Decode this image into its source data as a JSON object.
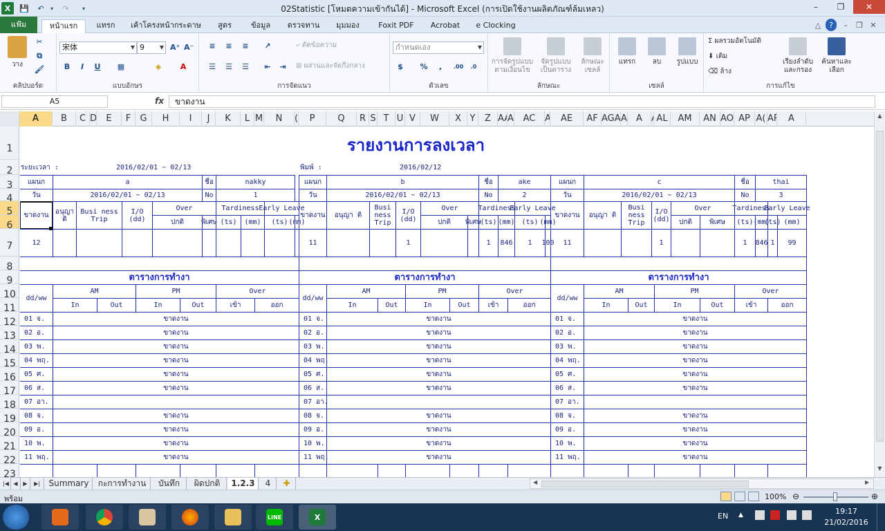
{
  "window": {
    "title": "02Statistic  [โหมดความเข้ากันได้] - Microsoft Excel (การเปิดใช้งานผลิตภัณฑ์ล้มเหลว)",
    "min": "–",
    "max": "❐",
    "close": "✕"
  },
  "ribbon_tabs": [
    "แฟ้ม",
    "หน้าแรก",
    "แทรก",
    "เค้าโครงหน้ากระดาษ",
    "สูตร",
    "ข้อมูล",
    "ตรวจทาน",
    "มุมมอง",
    "Foxit PDF",
    "Acrobat",
    "e Clocking"
  ],
  "ribbon": {
    "paste": "วาง",
    "clipboard": "คลิปบอร์ด",
    "font_name": "宋体",
    "font_size": "9",
    "font_group": "แบบอักษร",
    "wrap_text": "ตัดข้อความ",
    "merge_center": "ผสานและจัดกึ่งกลาง",
    "alignment_group": "การจัดแนว",
    "number_format": "กำหนดเอง",
    "number_group": "ตัวเลข",
    "cond_format": "การจัดรูปแบบ",
    "cond_format2": "ตามเงื่อนไข",
    "format_table": "จัดรูปแบบ",
    "format_table2": "เป็นตาราง",
    "cell_styles": "ลักษณะ",
    "cell_styles2": "เซลล์",
    "styles_group": "ลักษณะ",
    "insert": "แทรก",
    "delete": "ลบ",
    "format": "รูปแบบ",
    "cells_group": "เซลล์",
    "autosum": "ผลรวมอัตโนมัติ",
    "fill": "เติม",
    "clear": "ล้าง",
    "sort_filter": "เรียงลำดับ",
    "sort_filter2": "และกรอง",
    "find_select": "ค้นหาและ",
    "find_select2": "เลือก",
    "editing_group": "การแก้ไข",
    "percent": "%",
    "comma": ","
  },
  "formula_bar": {
    "name_box": "A5",
    "fx": "fx",
    "value": "ขาดงาน"
  },
  "columns": [
    "A",
    "B",
    "C",
    "D",
    "E",
    "F",
    "G",
    "H",
    "I",
    "J",
    "K",
    "L",
    "M",
    "N",
    "O",
    "P",
    "Q",
    "R",
    "S",
    "T",
    "U",
    "V",
    "W",
    "X",
    "Y",
    "Z",
    "AA",
    "AB",
    "AC",
    "AD",
    "AE",
    "AF",
    "AG",
    "AH",
    "AI",
    "AJ",
    "AK",
    "AL",
    "AM",
    "AN",
    "AO",
    "AP",
    "AQ",
    "AR",
    "AS"
  ],
  "column_labels": [
    "A",
    "B",
    "C",
    "D",
    "E",
    "F",
    "G",
    "H",
    "I",
    "J",
    "K",
    "L",
    "M",
    "N",
    "(",
    "P",
    "Q",
    "R",
    "S",
    "T",
    "U",
    "V",
    "W",
    "X",
    "Y",
    "Z",
    "AA",
    "A",
    "AC",
    "A",
    "AE",
    "AF",
    "AGA",
    "AI",
    "A",
    "AK",
    "AL",
    "AM",
    "AN",
    "AO",
    "AP",
    "A(",
    "AR",
    "A"
  ],
  "rows": [
    "1",
    "2",
    "3",
    "4",
    "5",
    "6",
    "7",
    "8",
    "9",
    "10",
    "11",
    "12",
    "13",
    "14",
    "15",
    "16",
    "17",
    "18",
    "19",
    "20",
    "21",
    "22",
    "23"
  ],
  "sheet": {
    "title": "รายงานการลงเวลา",
    "period_label": "ระยะเวลา :",
    "period_value": "2016/02/01 ~ 02/13",
    "print_label": "พิมพ์ :",
    "print_value": "2016/02/12",
    "dept_label": "แผนก",
    "name_label": "ชื่อ",
    "day_label": "วัน",
    "no_label": "No",
    "absent_head": "ขาดงาน",
    "approve_head": "อนุญา ติ",
    "business_head": "Busi ness Trip",
    "io_head": "I/O (dd)",
    "over_head": "Over",
    "tardiness_head": "Tardiness",
    "early_head": "Early Leave",
    "normal": "ปกติ",
    "special": "พิเศษ",
    "ts": "(ts)",
    "mm": "(mm)",
    "schedule_title": "ตารางการทำงา",
    "ddww": "dd/ww",
    "am": "AM",
    "pm": "PM",
    "over": "Over",
    "in": "In",
    "out": "Out",
    "enter": "เข้า",
    "exit": "ออก",
    "days": [
      "01 จ.",
      "02 อ.",
      "03 พ.",
      "04 พฤ.",
      "05 ศ.",
      "06 ส.",
      "07 อา.",
      "08 จ.",
      "09 อ.",
      "10 พ.",
      "11 พฤ."
    ],
    "absent_text": "ขาดงาน",
    "blocks": [
      {
        "dept": "a",
        "name": "nakky",
        "period": "2016/02/01 ~ 02/13",
        "no": "1",
        "absent": "12",
        "io": "",
        "tard_ts": "",
        "tard_mm": "",
        "early_ts": "",
        "early_mm": "",
        "schedule": [
          "ขาดงาน",
          "ขาดงาน",
          "ขาดงาน",
          "ขาดงาน",
          "ขาดงาน",
          "ขาดงาน",
          "",
          "ขาดงาน",
          "ขาดงาน",
          "ขาดงาน",
          "ขาดงาน"
        ]
      },
      {
        "dept": "b",
        "name": "ake",
        "period": "2016/02/01 ~ 02/13",
        "no": "2",
        "absent": "11",
        "io": "1",
        "tard_ts": "1",
        "tard_mm": "846",
        "early_ts": "1",
        "early_mm": "100",
        "schedule": [
          "ขาดงาน",
          "ขาดงาน",
          "ขาดงาน",
          "ขาดงาน",
          "ขาดงาน",
          "ขาดงาน",
          "",
          "ขาดงาน",
          "ขาดงาน",
          "ขาดงาน",
          "ขาดงาน"
        ]
      },
      {
        "dept": "c",
        "name": "thai",
        "period": "2016/02/01 ~ 02/13",
        "no": "3",
        "absent": "11",
        "io": "1",
        "tard_ts": "1",
        "tard_mm": "846",
        "early_ts": "1",
        "early_mm": "99",
        "schedule": [
          "ขาดงาน",
          "ขาดงาน",
          "ขาดงาน",
          "ขาดงาน",
          "ขาดงาน",
          "ขาดงาน",
          "",
          "ขาดงาน",
          "ขาดงาน",
          "ขาดงาน",
          "ขาดงาน"
        ]
      }
    ]
  },
  "sheet_tabs": [
    "Summary",
    "กะการทำงาน",
    "บันทึก",
    "ผิดปกติ",
    "1.2.3",
    "4"
  ],
  "active_sheet": "1.2.3",
  "status": {
    "ready": "พร้อม",
    "zoom": "100%"
  },
  "taskbar": {
    "lang": "EN",
    "time": "19:17",
    "date": "21/02/2016",
    "line": "LINE"
  }
}
